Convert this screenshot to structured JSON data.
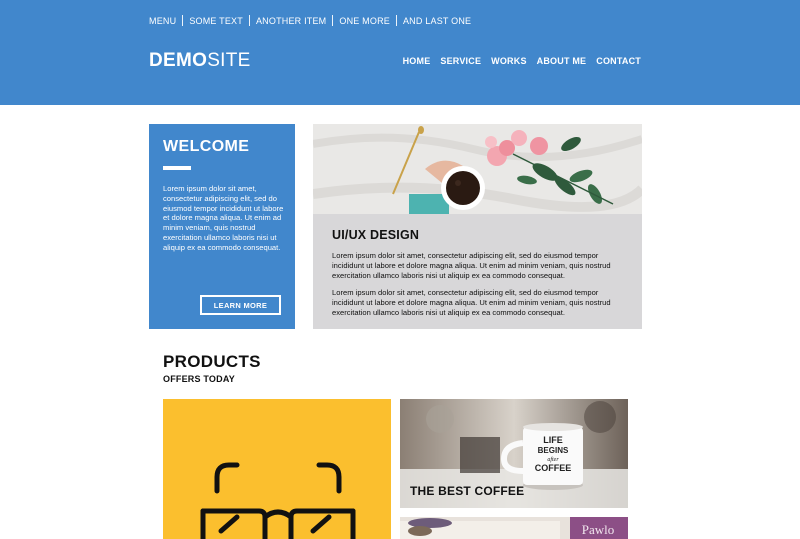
{
  "topmenu": [
    "MENU",
    "SOME TEXT",
    "ANOTHER ITEM",
    "ONE MORE",
    "AND LAST ONE"
  ],
  "logo": {
    "bold": "DEMO",
    "light": "SITE"
  },
  "nav": [
    "HOME",
    "SERVICE",
    "WORKS",
    "ABOUT ME",
    "CONTACT"
  ],
  "welcome": {
    "title": "WELCOME",
    "text": "Lorem ipsum dolor sit amet, consectetur adipiscing elit, sed do eiusmod tempor incididunt ut labore et dolore magna aliqua. Ut enim ad minim veniam, quis nostrud exercitation ullamco laboris nisi ut aliquip ex ea commodo consequat.",
    "button": "LEARN MORE"
  },
  "uiux": {
    "title": "UI/UX DESIGN",
    "p1": "Lorem ipsum dolor sit amet, consectetur adipiscing elit, sed do eiusmod tempor incididunt ut labore et dolore magna aliqua. Ut enim ad minim veniam, quis nostrud exercitation ullamco laboris nisi ut aliquip ex ea commodo consequat.",
    "p2": "Lorem ipsum dolor sit amet, consectetur adipiscing elit, sed do eiusmod tempor incididunt ut labore et dolore magna aliqua. Ut enim ad minim veniam, quis nostrud exercitation ullamco laboris nisi ut aliquip ex ea commodo consequat."
  },
  "products": {
    "title": "PRODUCTS",
    "subtitle": "OFFERS TODAY",
    "coffee_caption": "THE BEST COFFEE",
    "mug_text": [
      "LIFE",
      "BEGINS",
      "after",
      "COFFEE"
    ],
    "book_text": "Pawlo"
  },
  "colors": {
    "header_blue": "#4187cc",
    "panel_gray": "#d8d7d9",
    "product_yellow": "#fbbf2e"
  },
  "icons": {
    "product_yellow": "glasses-icon"
  }
}
